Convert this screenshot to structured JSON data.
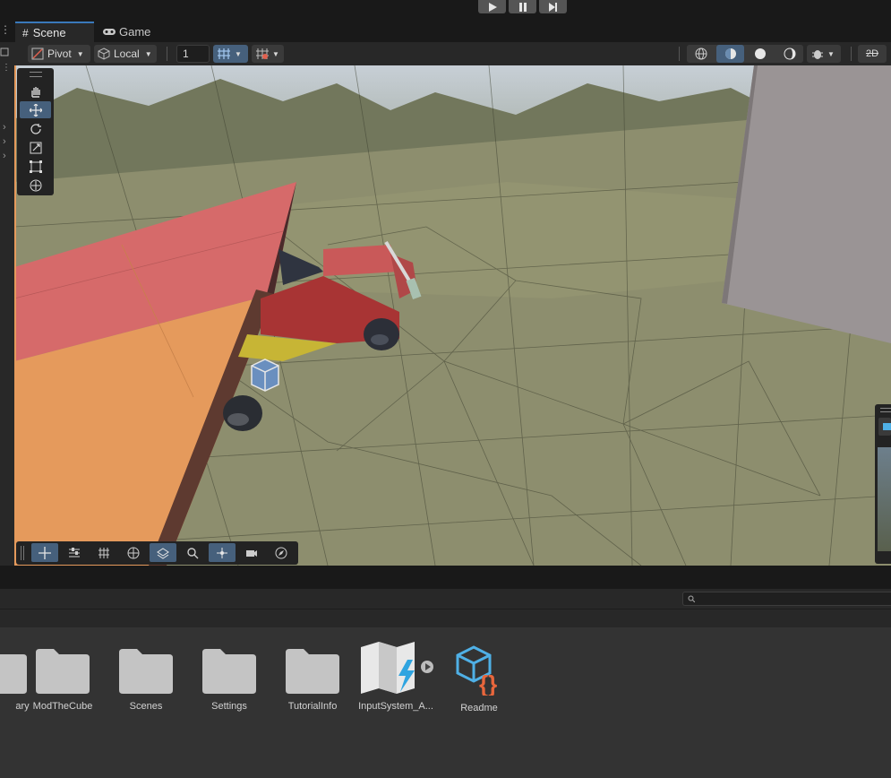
{
  "playbar": {
    "play_icon": "play-icon",
    "pause_icon": "pause-icon",
    "step_icon": "step-icon"
  },
  "tabs": [
    {
      "label": "Scene",
      "icon": "grid-icon",
      "active": true
    },
    {
      "label": "Game",
      "icon": "gamepad-icon",
      "active": false
    }
  ],
  "toolbar": {
    "pivot_label": "Pivot",
    "local_label": "Local",
    "snap_value": "1"
  },
  "tools": [
    "hand-tool",
    "move-tool",
    "rotate-tool",
    "scale-tool",
    "rect-tool",
    "transform-tool"
  ],
  "selected_tool": "move-tool",
  "project": {
    "search_placeholder": "",
    "assets": [
      {
        "label": "ary",
        "icon": "folder-icon"
      },
      {
        "label": "ModTheCube",
        "icon": "folder-icon"
      },
      {
        "label": "Scenes",
        "icon": "folder-icon"
      },
      {
        "label": "Settings",
        "icon": "folder-icon"
      },
      {
        "label": "TutorialInfo",
        "icon": "folder-icon"
      },
      {
        "label": "InputSystem_A...",
        "icon": "input-actions-icon"
      },
      {
        "label": "Readme",
        "icon": "readme-icon"
      }
    ]
  },
  "colors": {
    "accent": "#3a79bb",
    "selected": "#46607c",
    "ground": "#8d8e6e",
    "wing_red": "#d66a6a",
    "wing_orange": "#e59a5c",
    "readme_orange": "#e8663c",
    "readme_blue": "#4fb0e6"
  }
}
